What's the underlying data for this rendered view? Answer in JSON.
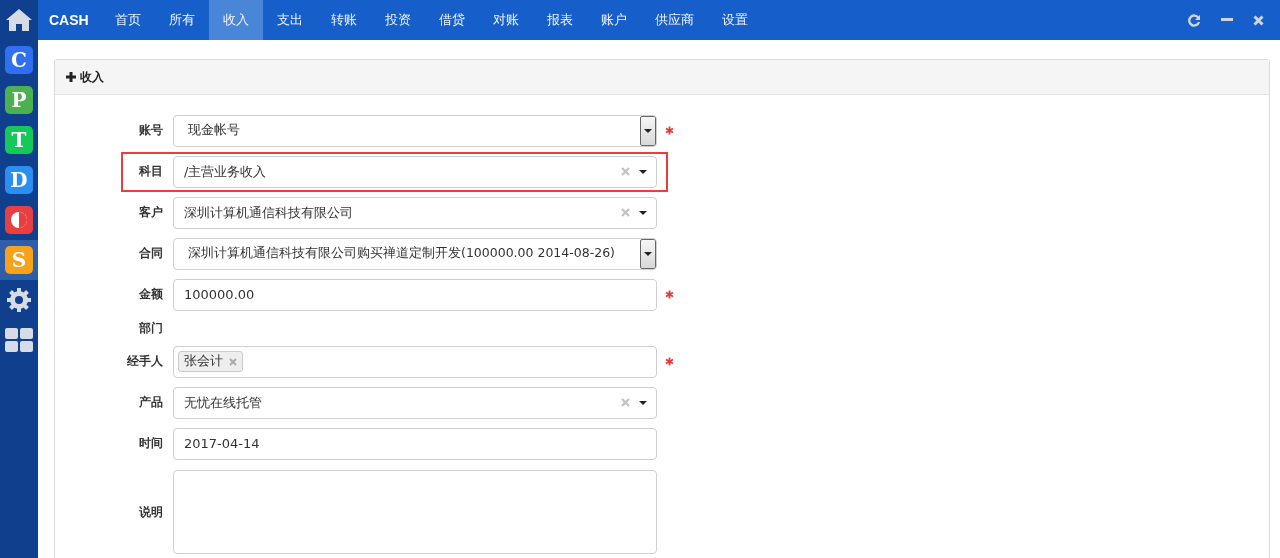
{
  "brand": "CASH",
  "nav": [
    {
      "label": "首页",
      "selected": false
    },
    {
      "label": "所有",
      "selected": false
    },
    {
      "label": "收入",
      "selected": true
    },
    {
      "label": "支出",
      "selected": false
    },
    {
      "label": "转账",
      "selected": false
    },
    {
      "label": "投资",
      "selected": false
    },
    {
      "label": "借贷",
      "selected": false
    },
    {
      "label": "对账",
      "selected": false
    },
    {
      "label": "报表",
      "selected": false
    },
    {
      "label": "账户",
      "selected": false
    },
    {
      "label": "供应商",
      "selected": false
    },
    {
      "label": "设置",
      "selected": false
    }
  ],
  "sidebar": [
    {
      "kind": "letter",
      "label": "C",
      "color": "#2f6ff0",
      "selected": false
    },
    {
      "kind": "letter",
      "label": "P",
      "color": "#4caf50",
      "selected": false
    },
    {
      "kind": "letter",
      "label": "T",
      "color": "#14c85a",
      "selected": false
    },
    {
      "kind": "letter",
      "label": "D",
      "color": "#2a8ff0",
      "selected": false
    },
    {
      "kind": "half",
      "color": "#e84040",
      "selected": false
    },
    {
      "kind": "letter",
      "label": "S",
      "color": "#f7a21b",
      "selected": true
    },
    {
      "kind": "gear",
      "selected": false
    },
    {
      "kind": "grid",
      "selected": false
    }
  ],
  "panel": {
    "title": "收入",
    "fields": [
      {
        "label": "账号",
        "kind": "select",
        "value": "现金帐号",
        "required": true,
        "highlighted": false
      },
      {
        "label": "科目",
        "kind": "combo",
        "value": "/主营业务收入",
        "required": false,
        "highlighted": true
      },
      {
        "label": "客户",
        "kind": "combo",
        "value": "深圳计算机通信科技有限公司",
        "required": false,
        "highlighted": false
      },
      {
        "label": "合同",
        "kind": "select",
        "value": "深圳计算机通信科技有限公司购买禅道定制开发(100000.00 2014-08-26)",
        "required": false,
        "highlighted": false
      },
      {
        "label": "金额",
        "kind": "input",
        "value": "100000.00",
        "required": true,
        "highlighted": false
      },
      {
        "label": "部门",
        "kind": "none",
        "required": false,
        "highlighted": false
      },
      {
        "label": "经手人",
        "kind": "tags",
        "tags": [
          "张会计"
        ],
        "required": true,
        "highlighted": false
      },
      {
        "label": "产品",
        "kind": "combo",
        "value": "无忧在线托管",
        "required": false,
        "highlighted": false
      },
      {
        "label": "时间",
        "kind": "input",
        "value": "2017-04-14",
        "required": false,
        "highlighted": false
      },
      {
        "label": "说明",
        "kind": "textarea",
        "required": false,
        "highlighted": false
      }
    ]
  }
}
